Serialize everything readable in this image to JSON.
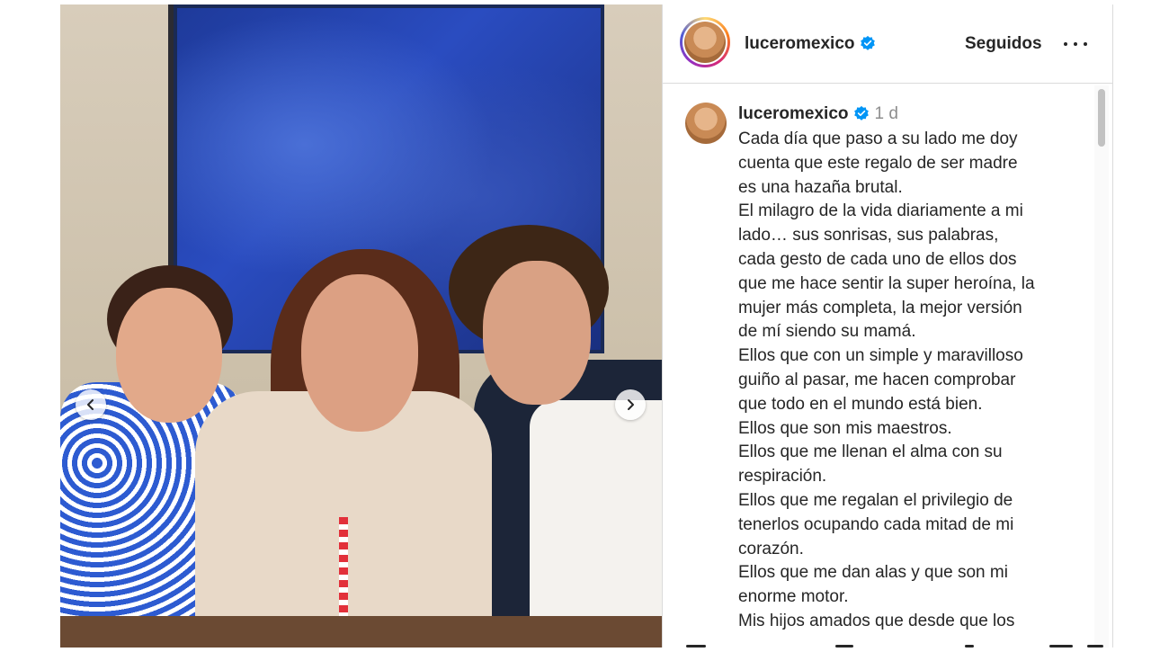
{
  "post": {
    "photo_alt": "Three smiling people seated in front of a blue painting",
    "carousel": {
      "prev_icon": "chevron-left-icon",
      "next_icon": "chevron-right-icon"
    }
  },
  "header": {
    "username": "luceromexico",
    "verified_icon": "verified-badge-icon",
    "follow_label": "Seguidos",
    "more_icon": "more-horizontal-icon"
  },
  "caption": {
    "username": "luceromexico",
    "time": "1 d",
    "lines": [
      "Cada día que paso a su lado me doy",
      "cuenta que este regalo de ser madre",
      "es una hazaña brutal.",
      "El milagro de la vida diariamente a mi",
      "lado… sus sonrisas, sus palabras,",
      "cada gesto de cada uno de ellos dos",
      "que me hace sentir la super heroína, la",
      "mujer más completa, la mejor versión",
      "de mí siendo su mamá.",
      "Ellos que con un simple y maravilloso",
      "guiño al pasar, me hacen comprobar",
      "que todo en el mundo está bien.",
      "Ellos que son mis maestros.",
      "Ellos que me llenan el alma con su",
      "respiración.",
      "Ellos que me regalan el privilegio de",
      "tenerlos ocupando cada mitad de mi",
      "corazón.",
      "Ellos que me dan alas y que son mi",
      "enorme motor.",
      "Mis hijos amados que desde que los"
    ]
  },
  "colors": {
    "verified_blue": "#0095f6",
    "text": "#262626",
    "muted": "#8e8e8e",
    "border": "#dbdbdb"
  }
}
